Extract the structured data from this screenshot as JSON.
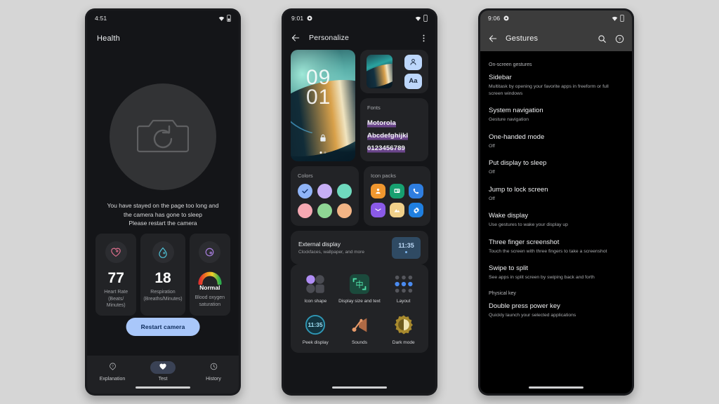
{
  "background_color": "#d6d6d6",
  "phone1": {
    "status_bar": {
      "time": "4:51",
      "icons": [
        "wifi-icon",
        "battery-icon"
      ]
    },
    "app_title": "Health",
    "camera_icon": "camera-refresh-icon",
    "message": "You have stayed on the page too long and the camera has gone to sleep\nPlease restart the camera",
    "message_lines": [
      "You have stayed on the page too long and",
      "the camera has gone to sleep",
      "Please restart the camera"
    ],
    "stats": [
      {
        "icon": "heart-icon",
        "icon_color": "#e0708f",
        "value": "77",
        "label": "Heart Rate (Beats/ Minutes)"
      },
      {
        "icon": "water-drop-icon",
        "icon_color": "#4fc3d9",
        "value": "18",
        "label": "Respiration (Breaths/Minutes)"
      },
      {
        "icon": "oxygen-icon",
        "icon_color": "#a97fe0",
        "value": "Normal",
        "label": "Blood oxygen saturation",
        "gauge": true
      }
    ],
    "primary_button": {
      "label": "Restart camera",
      "bg": "#a9c7fa",
      "fg": "#0c2b5b"
    },
    "bottom_nav": [
      {
        "icon": "help-balloon-icon",
        "label": "Explanation",
        "active": false
      },
      {
        "icon": "heart-filled-icon",
        "label": "Test",
        "active": true
      },
      {
        "icon": "clock-icon",
        "label": "History",
        "active": false
      }
    ]
  },
  "phone2": {
    "status_bar": {
      "time": "9:01",
      "icons": [
        "location-icon",
        "wifi-icon",
        "battery-icon"
      ]
    },
    "appbar": {
      "back_icon": "arrow-back-icon",
      "title": "Personalize",
      "menu_icon": "more-vert-icon"
    },
    "wallpaper_card": {
      "clock_hours": "09",
      "clock_minutes": "01",
      "lock_icon": "lock-icon",
      "page_dots": 2,
      "active_dot": 0
    },
    "quick_card": {
      "buttons": [
        {
          "icon": "person-icon",
          "label": ""
        },
        {
          "icon": "font-icon",
          "label": "Aa"
        }
      ]
    },
    "fonts_card": {
      "header": "Fonts",
      "lines": [
        "Motorola",
        "Abcdefghijkl",
        "0123456789"
      ],
      "highlight_color": "#965ac8"
    },
    "colors_card": {
      "header": "Colors",
      "swatches": [
        "#8fb4f7",
        "#c6aef5",
        "#6fd9bd",
        "#f5a8b2",
        "#8ed694",
        "#f2b485"
      ],
      "selected_index": 0,
      "check_icon": "check-icon"
    },
    "icon_packs_card": {
      "header": "Icon packs",
      "icons": [
        {
          "name": "contacts-icon",
          "bg": "#f0972f"
        },
        {
          "name": "messages-icon",
          "bg": "#17a070"
        },
        {
          "name": "phone-icon",
          "bg": "#2f7ee0"
        },
        {
          "name": "mail-icon",
          "bg": "#8a5ae8"
        },
        {
          "name": "photos-icon",
          "bg": "#f0d08a"
        },
        {
          "name": "settings-gear-icon",
          "bg": "#1f7fe0"
        }
      ]
    },
    "external_display_card": {
      "title": "External display",
      "subtitle": "Clockfaces, wallpaper, and more",
      "thumb_time": "11:35"
    },
    "grid_card": {
      "items": [
        {
          "icon": "icon-shape-icon",
          "label": "Icon shape"
        },
        {
          "icon": "display-size-icon",
          "label": "Display size and text"
        },
        {
          "icon": "layout-grid-icon",
          "label": "Layout"
        },
        {
          "icon": "peek-display-icon",
          "label": "Peek display"
        },
        {
          "icon": "sounds-icon",
          "label": "Sounds"
        },
        {
          "icon": "dark-mode-icon",
          "label": "Dark mode"
        }
      ]
    }
  },
  "phone3": {
    "status_bar": {
      "time": "9:06",
      "icons": [
        "location-icon",
        "wifi-icon",
        "battery-icon"
      ]
    },
    "appbar": {
      "back_icon": "arrow-back-icon",
      "title": "Gestures",
      "search_icon": "search-icon",
      "help_icon": "help-circle-icon"
    },
    "sections": [
      {
        "header": "On-screen gestures",
        "items": [
          {
            "title": "Sidebar",
            "subtitle": "Multitask by opening your favorite apps in freeform or full screen windows"
          },
          {
            "title": "System navigation",
            "subtitle": "Gesture navigation"
          },
          {
            "title": "One-handed mode",
            "subtitle": "Off"
          },
          {
            "title": "Put display to sleep",
            "subtitle": "Off"
          },
          {
            "title": "Jump to lock screen",
            "subtitle": "Off"
          },
          {
            "title": "Wake display",
            "subtitle": "Use gestures to wake your display up"
          },
          {
            "title": "Three finger screenshot",
            "subtitle": "Touch the screen with three fingers to take a screenshot"
          },
          {
            "title": "Swipe to split",
            "subtitle": "See apps in split screen by swiping back and forth"
          }
        ]
      },
      {
        "header": "Physical key",
        "items": [
          {
            "title": "Double press power key",
            "subtitle": "Quickly launch your selected applications"
          }
        ]
      }
    ]
  }
}
